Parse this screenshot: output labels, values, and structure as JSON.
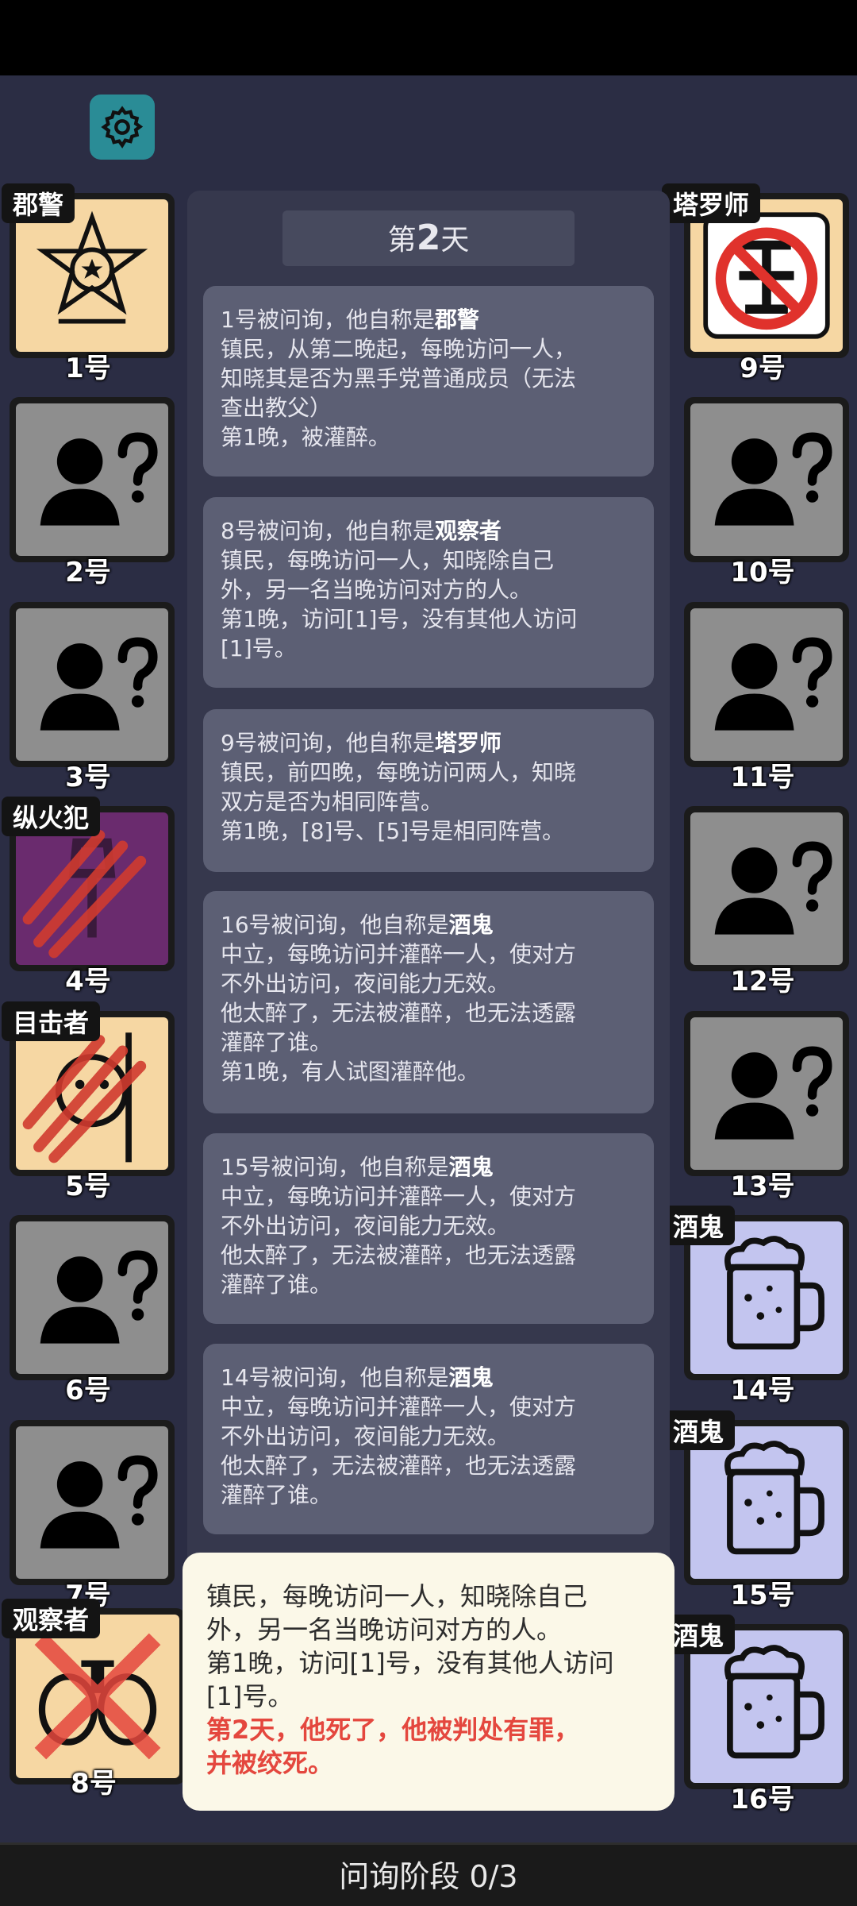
{
  "header": {
    "day_prefix": "第",
    "day_number": "2",
    "day_suffix": "天"
  },
  "icons": {
    "settings": "gear-icon"
  },
  "players_left": [
    {
      "num": "1号",
      "role": "郡警",
      "state": "known",
      "icon": "sheriff-badge-icon"
    },
    {
      "num": "2号",
      "role": "",
      "state": "unknown",
      "icon": "unknown-person-icon"
    },
    {
      "num": "3号",
      "role": "",
      "state": "unknown",
      "icon": "unknown-person-icon"
    },
    {
      "num": "4号",
      "role": "纵火犯",
      "state": "dead",
      "icon": "arsonist-icon"
    },
    {
      "num": "5号",
      "role": "目击者",
      "state": "dead",
      "icon": "witness-icon"
    },
    {
      "num": "6号",
      "role": "",
      "state": "unknown",
      "icon": "unknown-person-icon"
    },
    {
      "num": "7号",
      "role": "",
      "state": "unknown",
      "icon": "unknown-person-icon"
    },
    {
      "num": "8号",
      "role": "观察者",
      "state": "dead",
      "icon": "binoculars-icon"
    }
  ],
  "players_right": [
    {
      "num": "9号",
      "role": "塔罗师",
      "state": "fake",
      "icon": "fake-stamp-icon"
    },
    {
      "num": "10号",
      "role": "",
      "state": "unknown",
      "icon": "unknown-person-icon"
    },
    {
      "num": "11号",
      "role": "",
      "state": "unknown",
      "icon": "unknown-person-icon"
    },
    {
      "num": "12号",
      "role": "",
      "state": "unknown",
      "icon": "unknown-person-icon"
    },
    {
      "num": "13号",
      "role": "",
      "state": "unknown",
      "icon": "unknown-person-icon"
    },
    {
      "num": "14号",
      "role": "酒鬼",
      "state": "known",
      "icon": "beer-mug-icon"
    },
    {
      "num": "15号",
      "role": "酒鬼",
      "state": "known",
      "icon": "beer-mug-icon"
    },
    {
      "num": "16号",
      "role": "酒鬼",
      "state": "known",
      "icon": "beer-mug-icon"
    }
  ],
  "messages": [
    {
      "head": "1号被问询，他自称是",
      "role": "郡警",
      "lines": [
        "镇民，从第二晚起，每晚访问一人，",
        "知晓其是否为黑手党普通成员（无法",
        "查出教父）",
        "第1晚，被灌醉。"
      ]
    },
    {
      "head": "8号被问询，他自称是",
      "role": "观察者",
      "lines": [
        "镇民，每晚访问一人，知晓除自己",
        "外，另一名当晚访问对方的人。",
        "第1晚，访问[1]号，没有其他人访问",
        "[1]号。"
      ]
    },
    {
      "head": "9号被问询，他自称是",
      "role": "塔罗师",
      "lines": [
        "镇民，前四晚，每晚访问两人，知晓",
        "双方是否为相同阵营。",
        "第1晚，[8]号、[5]号是相同阵营。"
      ]
    },
    {
      "head": "16号被问询，他自称是",
      "role": "酒鬼",
      "lines": [
        "中立，每晚访问并灌醉一人，使对方",
        "不外出访问，夜间能力无效。",
        "他太醉了，无法被灌醉，也无法透露",
        "灌醉了谁。",
        "第1晚，有人试图灌醉他。"
      ]
    },
    {
      "head": "15号被问询，他自称是",
      "role": "酒鬼",
      "lines": [
        "中立，每晚访问并灌醉一人，使对方",
        "不外出访问，夜间能力无效。",
        "他太醉了，无法被灌醉，也无法透露",
        "灌醉了谁。"
      ]
    },
    {
      "head": "14号被问询，他自称是",
      "role": "酒鬼",
      "lines": [
        "中立，每晚访问并灌醉一人，使对方",
        "不外出访问，夜间能力无效。",
        "他太醉了，无法被灌醉，也无法透露",
        "灌醉了谁。"
      ]
    }
  ],
  "popup": {
    "lines": [
      "镇民，每晚访问一人，知晓除自己",
      "外，另一名当晚访问对方的人。",
      "第1晚，访问[1]号，没有其他人访问",
      "[1]号。"
    ],
    "death_lines": [
      "第2天，他死了，他被判处有罪，",
      "并被绞死。"
    ]
  },
  "footer": {
    "phase": "问询阶段 0/3"
  },
  "colors": {
    "background": "#2b2d44",
    "unknown_card": "#8e8e8e",
    "known_card": "#f6d7a3",
    "drunk_card": "#c3c5ef",
    "accent_red": "#e4473e",
    "settings_button": "#2a8c96"
  }
}
